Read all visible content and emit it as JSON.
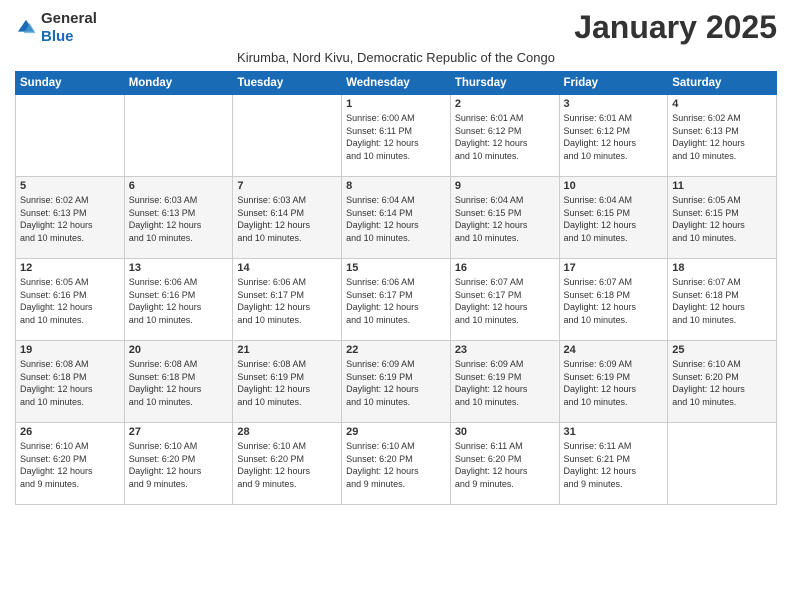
{
  "logo": {
    "general": "General",
    "blue": "Blue"
  },
  "header": {
    "month_year": "January 2025",
    "location": "Kirumba, Nord Kivu, Democratic Republic of the Congo"
  },
  "weekdays": [
    "Sunday",
    "Monday",
    "Tuesday",
    "Wednesday",
    "Thursday",
    "Friday",
    "Saturday"
  ],
  "weeks": [
    [
      {
        "day": "",
        "info": ""
      },
      {
        "day": "",
        "info": ""
      },
      {
        "day": "",
        "info": ""
      },
      {
        "day": "1",
        "info": "Sunrise: 6:00 AM\nSunset: 6:11 PM\nDaylight: 12 hours\nand 10 minutes."
      },
      {
        "day": "2",
        "info": "Sunrise: 6:01 AM\nSunset: 6:12 PM\nDaylight: 12 hours\nand 10 minutes."
      },
      {
        "day": "3",
        "info": "Sunrise: 6:01 AM\nSunset: 6:12 PM\nDaylight: 12 hours\nand 10 minutes."
      },
      {
        "day": "4",
        "info": "Sunrise: 6:02 AM\nSunset: 6:13 PM\nDaylight: 12 hours\nand 10 minutes."
      }
    ],
    [
      {
        "day": "5",
        "info": "Sunrise: 6:02 AM\nSunset: 6:13 PM\nDaylight: 12 hours\nand 10 minutes."
      },
      {
        "day": "6",
        "info": "Sunrise: 6:03 AM\nSunset: 6:13 PM\nDaylight: 12 hours\nand 10 minutes."
      },
      {
        "day": "7",
        "info": "Sunrise: 6:03 AM\nSunset: 6:14 PM\nDaylight: 12 hours\nand 10 minutes."
      },
      {
        "day": "8",
        "info": "Sunrise: 6:04 AM\nSunset: 6:14 PM\nDaylight: 12 hours\nand 10 minutes."
      },
      {
        "day": "9",
        "info": "Sunrise: 6:04 AM\nSunset: 6:15 PM\nDaylight: 12 hours\nand 10 minutes."
      },
      {
        "day": "10",
        "info": "Sunrise: 6:04 AM\nSunset: 6:15 PM\nDaylight: 12 hours\nand 10 minutes."
      },
      {
        "day": "11",
        "info": "Sunrise: 6:05 AM\nSunset: 6:15 PM\nDaylight: 12 hours\nand 10 minutes."
      }
    ],
    [
      {
        "day": "12",
        "info": "Sunrise: 6:05 AM\nSunset: 6:16 PM\nDaylight: 12 hours\nand 10 minutes."
      },
      {
        "day": "13",
        "info": "Sunrise: 6:06 AM\nSunset: 6:16 PM\nDaylight: 12 hours\nand 10 minutes."
      },
      {
        "day": "14",
        "info": "Sunrise: 6:06 AM\nSunset: 6:17 PM\nDaylight: 12 hours\nand 10 minutes."
      },
      {
        "day": "15",
        "info": "Sunrise: 6:06 AM\nSunset: 6:17 PM\nDaylight: 12 hours\nand 10 minutes."
      },
      {
        "day": "16",
        "info": "Sunrise: 6:07 AM\nSunset: 6:17 PM\nDaylight: 12 hours\nand 10 minutes."
      },
      {
        "day": "17",
        "info": "Sunrise: 6:07 AM\nSunset: 6:18 PM\nDaylight: 12 hours\nand 10 minutes."
      },
      {
        "day": "18",
        "info": "Sunrise: 6:07 AM\nSunset: 6:18 PM\nDaylight: 12 hours\nand 10 minutes."
      }
    ],
    [
      {
        "day": "19",
        "info": "Sunrise: 6:08 AM\nSunset: 6:18 PM\nDaylight: 12 hours\nand 10 minutes."
      },
      {
        "day": "20",
        "info": "Sunrise: 6:08 AM\nSunset: 6:18 PM\nDaylight: 12 hours\nand 10 minutes."
      },
      {
        "day": "21",
        "info": "Sunrise: 6:08 AM\nSunset: 6:19 PM\nDaylight: 12 hours\nand 10 minutes."
      },
      {
        "day": "22",
        "info": "Sunrise: 6:09 AM\nSunset: 6:19 PM\nDaylight: 12 hours\nand 10 minutes."
      },
      {
        "day": "23",
        "info": "Sunrise: 6:09 AM\nSunset: 6:19 PM\nDaylight: 12 hours\nand 10 minutes."
      },
      {
        "day": "24",
        "info": "Sunrise: 6:09 AM\nSunset: 6:19 PM\nDaylight: 12 hours\nand 10 minutes."
      },
      {
        "day": "25",
        "info": "Sunrise: 6:10 AM\nSunset: 6:20 PM\nDaylight: 12 hours\nand 10 minutes."
      }
    ],
    [
      {
        "day": "26",
        "info": "Sunrise: 6:10 AM\nSunset: 6:20 PM\nDaylight: 12 hours\nand 9 minutes."
      },
      {
        "day": "27",
        "info": "Sunrise: 6:10 AM\nSunset: 6:20 PM\nDaylight: 12 hours\nand 9 minutes."
      },
      {
        "day": "28",
        "info": "Sunrise: 6:10 AM\nSunset: 6:20 PM\nDaylight: 12 hours\nand 9 minutes."
      },
      {
        "day": "29",
        "info": "Sunrise: 6:10 AM\nSunset: 6:20 PM\nDaylight: 12 hours\nand 9 minutes."
      },
      {
        "day": "30",
        "info": "Sunrise: 6:11 AM\nSunset: 6:20 PM\nDaylight: 12 hours\nand 9 minutes."
      },
      {
        "day": "31",
        "info": "Sunrise: 6:11 AM\nSunset: 6:21 PM\nDaylight: 12 hours\nand 9 minutes."
      },
      {
        "day": "",
        "info": ""
      }
    ]
  ]
}
